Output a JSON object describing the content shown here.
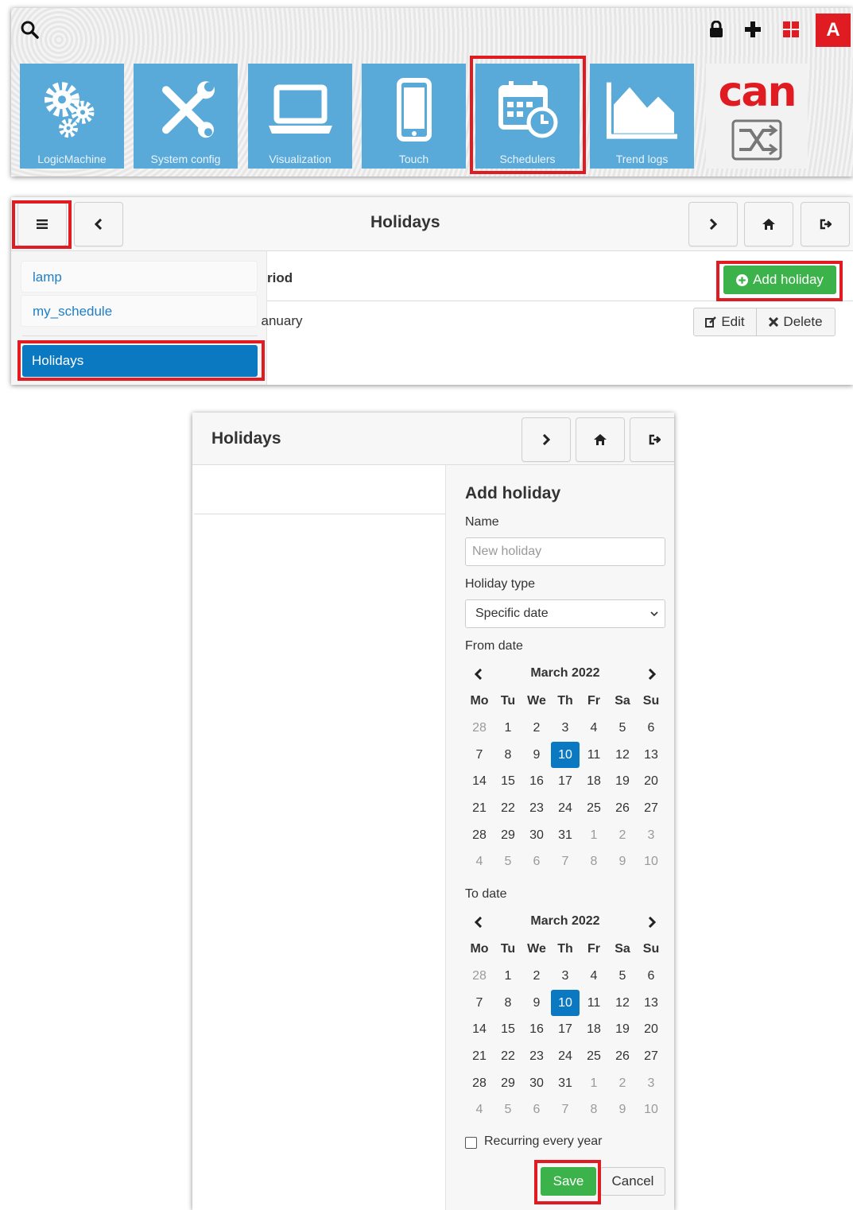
{
  "launcher": {
    "tiles": [
      {
        "label": "LogicMachine",
        "icon": "gears-icon"
      },
      {
        "label": "System config",
        "icon": "tools-icon"
      },
      {
        "label": "Visualization",
        "icon": "laptop-icon"
      },
      {
        "label": "Touch",
        "icon": "phone-icon"
      },
      {
        "label": "Schedulers",
        "icon": "calendar-clock-icon"
      },
      {
        "label": "Trend logs",
        "icon": "area-chart-icon"
      }
    ],
    "brand": {
      "logo_text": "can"
    },
    "user_badge": "A"
  },
  "holidays_list": {
    "title": "Holidays",
    "column_header": "riod",
    "add_button": "Add holiday",
    "row": {
      "period": "January",
      "edit": "Edit",
      "delete": "Delete"
    },
    "sidebar": {
      "items": [
        "lamp",
        "my_schedule"
      ],
      "active": "Holidays"
    }
  },
  "add_holiday_dialog": {
    "title": "Holidays",
    "form_title": "Add holiday",
    "name_label": "Name",
    "name_placeholder": "New holiday",
    "type_label": "Holiday type",
    "type_options": [
      "Specific date"
    ],
    "type_selected": "Specific date",
    "from_label": "From date",
    "to_label": "To date",
    "calendar": {
      "month": "March 2022",
      "weekdays": [
        "Mo",
        "Tu",
        "We",
        "Th",
        "Fr",
        "Sa",
        "Su"
      ],
      "days": [
        [
          "28",
          "1",
          "2",
          "3",
          "4",
          "5",
          "6"
        ],
        [
          "7",
          "8",
          "9",
          "10",
          "11",
          "12",
          "13"
        ],
        [
          "14",
          "15",
          "16",
          "17",
          "18",
          "19",
          "20"
        ],
        [
          "21",
          "22",
          "23",
          "24",
          "25",
          "26",
          "27"
        ],
        [
          "28",
          "29",
          "30",
          "31",
          "1",
          "2",
          "3"
        ],
        [
          "4",
          "5",
          "6",
          "7",
          "8",
          "9",
          "10"
        ]
      ],
      "selected_day": "10"
    },
    "recurring_label": "Recurring every year",
    "save": "Save",
    "cancel": "Cancel"
  },
  "colors": {
    "tile_blue": "#59a9d9",
    "selection_blue": "#0b78c2",
    "action_green": "#3cb24a",
    "highlight_red": "#e01b22"
  }
}
